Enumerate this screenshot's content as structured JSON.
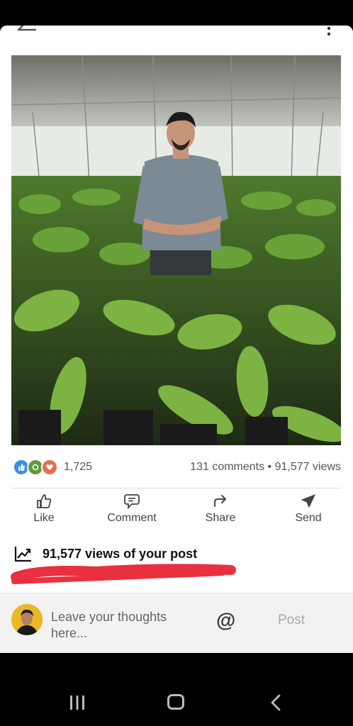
{
  "post": {
    "reaction_count": "1,725",
    "stats": "131 comments • 91,577 views"
  },
  "actions": {
    "like": "Like",
    "comment": "Comment",
    "share": "Share",
    "send": "Send"
  },
  "views_line": "91,577 views of your post",
  "comment_bar": {
    "placeholder": "Leave your thoughts here...",
    "mention_symbol": "@",
    "post_label": "Post"
  },
  "icons": [
    "back-arrow-icon",
    "more-vert-icon",
    "like-reaction-icon",
    "support-reaction-icon",
    "love-reaction-icon",
    "like-icon",
    "comment-icon",
    "share-icon",
    "send-icon",
    "chart-trend-icon",
    "at-icon",
    "recent-apps-icon",
    "home-icon",
    "nav-back-icon"
  ],
  "colors": {
    "like_blue": "#378fe9",
    "support_green": "#5f9b41",
    "love_orange": "#df704d",
    "annotation_red": "#e8303f"
  }
}
